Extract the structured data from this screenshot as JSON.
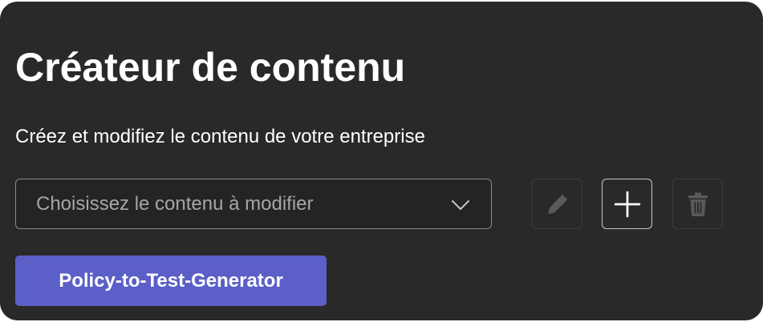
{
  "header": {
    "title": "Créateur de contenu",
    "subtitle": "Créez et modifiez le contenu de votre entreprise"
  },
  "content_select": {
    "placeholder": "Choisissez le contenu à modifier",
    "icon": "chevron-down-icon"
  },
  "actions": {
    "edit": {
      "icon": "pencil-icon",
      "enabled": false
    },
    "add": {
      "icon": "plus-icon",
      "enabled": true
    },
    "delete": {
      "icon": "trash-icon",
      "enabled": false
    }
  },
  "content_button": {
    "label": "Policy-to-Test-Generator"
  },
  "colors": {
    "background": "#292929",
    "accent": "#5b5fc7",
    "text": "#ffffff",
    "placeholder": "#a6a6a6",
    "disabled_icon": "#5a5a5a"
  }
}
